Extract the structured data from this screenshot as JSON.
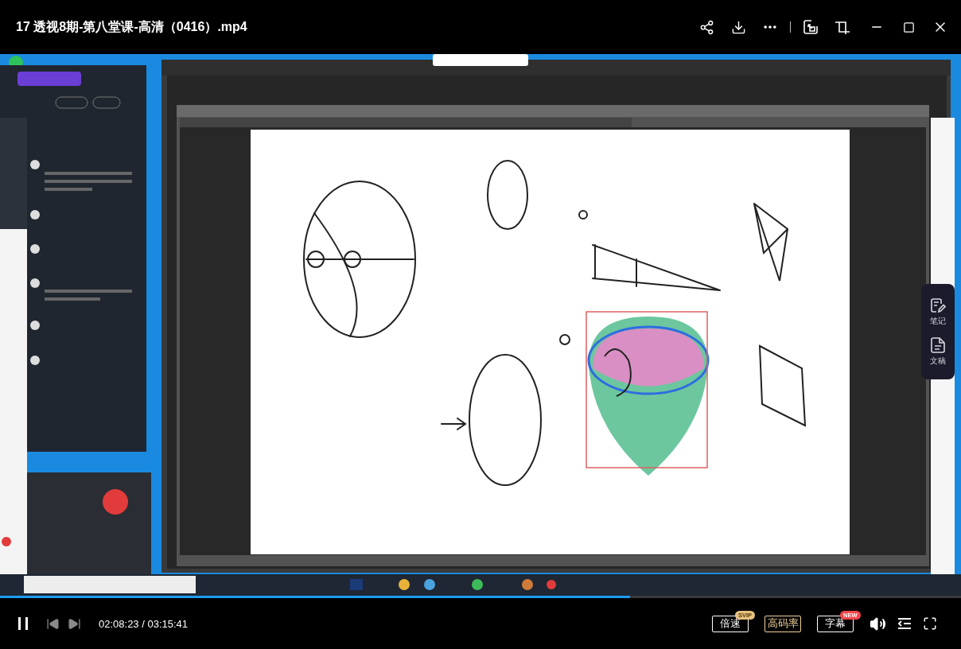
{
  "window": {
    "title": "17 透视8期-第八堂课-高清（0416）.mp4"
  },
  "side_panel": {
    "items": [
      {
        "kind": "notes",
        "label": "笔记"
      },
      {
        "kind": "transcript",
        "label": "文稿"
      }
    ]
  },
  "player": {
    "progress": {
      "level": 0.656
    },
    "playing": true,
    "time": "02:08:23 / 03:15:41",
    "buttons": [
      {
        "label": "倍速",
        "selected": false,
        "badge": {
          "text": "SVIP",
          "color": "#e6c17f"
        }
      },
      {
        "label": "高码率",
        "selected": true
      },
      {
        "label": "字幕",
        "selected": false,
        "badge": {
          "text": "NEW",
          "color": "#f5454a"
        }
      }
    ]
  }
}
